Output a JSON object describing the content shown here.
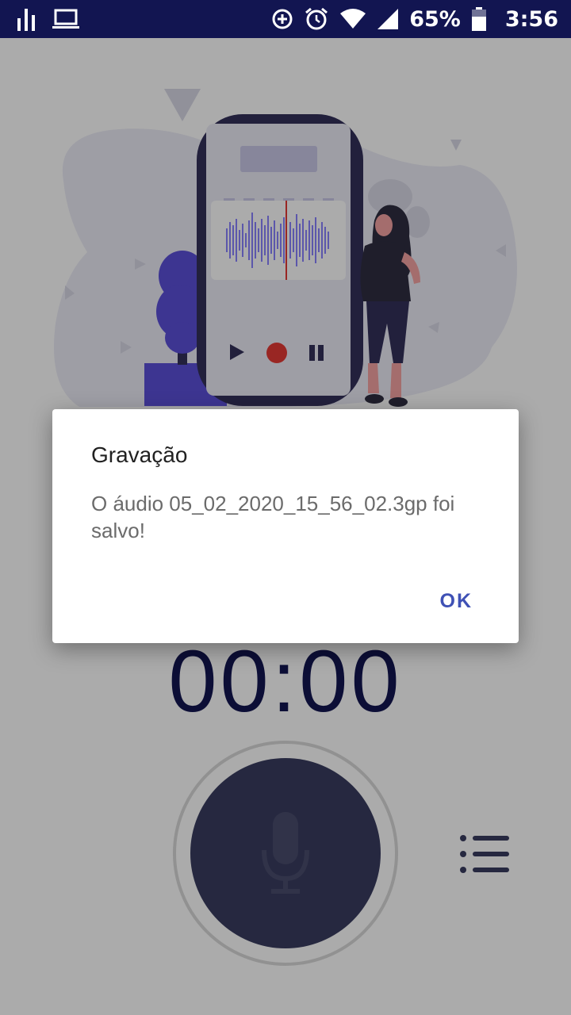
{
  "statusbar": {
    "battery_percent": "65%",
    "time": "3:56",
    "icons": [
      "signal-bars-icon",
      "laptop-icon",
      "data-saver-icon",
      "alarm-icon",
      "wifi-icon",
      "cell-signal-icon",
      "battery-icon"
    ]
  },
  "recorder": {
    "timer": "00:00",
    "record_button_icon": "microphone-icon",
    "list_button_icon": "list-icon"
  },
  "dialog": {
    "title": "Gravação",
    "message": "O áudio 05_02_2020_15_56_02.3gp foi salvo!",
    "ok_label": "OK"
  },
  "colors": {
    "statusbar": "#121551",
    "timer": "#121551",
    "record_button": "#3a3d60",
    "accent": "#3f51b5",
    "plant": "#5b4fd9",
    "phone_frame": "#33305a",
    "waveform": "#6c63ff",
    "record_dot": "#e53935",
    "blob": "#ececf7"
  }
}
